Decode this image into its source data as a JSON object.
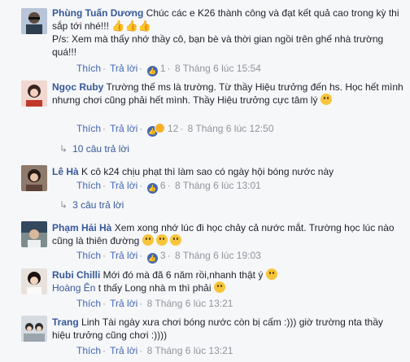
{
  "comments": [
    {
      "name": "Phùng Tuấn Dương",
      "text": "Chúc các e K26 thành công và đạt kết quả cao trong kỳ thi sắp tới nhé!!!",
      "text2": "P/s: Xem mà thấy nhớ thầy cô, bạn bè và thời gian ngồi trên ghế nhà trường quá!!!",
      "like": "Thích",
      "reply": "Trả lời",
      "reactions": "1",
      "time": "8 Tháng 6 lúc 15:54"
    },
    {
      "name": "Ngọc Ruby",
      "text": "Trường thế ms là trường. Từ thầy Hiệu trưởng đến hs. Học hết mình nhưng chơi cũng phải hết mình. Thầy Hiệu trưởng cực tâm lý",
      "like": "Thích",
      "reply": "Trả lời",
      "reactions": "12",
      "time": "8 Tháng 6 lúc 12:50",
      "replies": "10 câu trả lời"
    },
    {
      "name": "Lê Hà",
      "text": "K cô k24 chịu phạt thì làm sao có ngày hội bóng nước này",
      "like": "Thích",
      "reply": "Trả lời",
      "reactions": "6",
      "time": "8 Tháng 6 lúc 13:01",
      "replies": "3 câu trả lời"
    },
    {
      "name": "Phạm Hải Hà",
      "text": "Xem xong nhớ lúc đi học chảy cả nước mắt. Trường học lúc nào cũng là thiên đường",
      "like": "Thích",
      "reply": "Trả lời",
      "reactions": "3",
      "time": "8 Tháng 6 lúc 19:03"
    },
    {
      "name": "Rubi Chilli",
      "text": "Mới đó mà đã 6 năm rồi,nhanh thật ý",
      "mention": "Hoàng Ên",
      "text2": "t thấy Long nhà m thì phải",
      "like": "Thích",
      "reply": "Trả lời",
      "time": "8 Tháng 6 lúc 13:21"
    },
    {
      "name": "Trang",
      "text": "Linh Tài ngày xưa chơi bóng nước còn bị cấm :))) giờ trường nta thầy hiệu trưởng cũng chơi :))))",
      "like": "Thích",
      "reply": "Trả lời",
      "time": "8 Tháng 6 lúc 13:21"
    }
  ],
  "colors": {
    "link": "#365899",
    "meta": "#90949c",
    "accent": "#4267b2"
  }
}
